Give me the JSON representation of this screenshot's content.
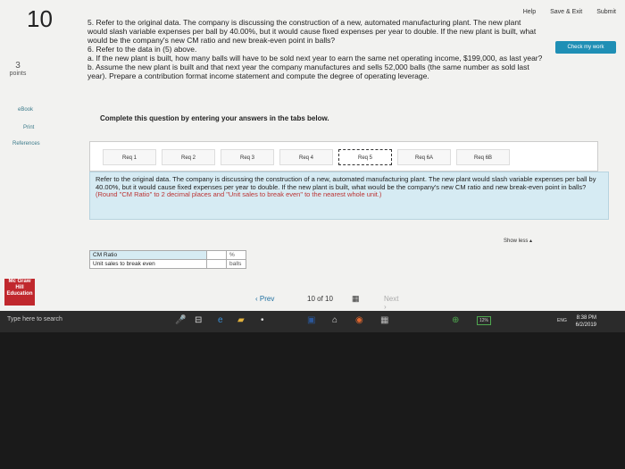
{
  "header": {
    "question_number": "10",
    "help": "Help",
    "save_exit": "Save & Exit",
    "submit": "Submit",
    "check_work": "Check my work"
  },
  "sidebar": {
    "points_value": "3",
    "points_label": "points",
    "links": [
      "eBook",
      "Print",
      "References"
    ]
  },
  "question": {
    "line1": "5. Refer to the original data. The company is discussing the construction of a new, automated manufacturing plant. The new plant",
    "line2": "would slash variable expenses per ball by 40.00%, but it would cause fixed expenses per year to double. If the new plant is built, what",
    "line3": "would be the company's new CM ratio and new break-even point in balls?",
    "line4": "6. Refer to the data in (5) above.",
    "line5": "a. If the new plant is built, how many balls will have to be sold next year to earn the same net operating income, $199,000, as last year?",
    "line6": "b. Assume the new plant is built and that next year the company manufactures and sells 52,000 balls (the same number as sold last",
    "line7": "year). Prepare a contribution format income statement and compute the degree of operating leverage."
  },
  "instruction": "Complete this question by entering your answers in the tabs below.",
  "tabs": [
    "Req 1",
    "Req 2",
    "Req 3",
    "Req 4",
    "Req 5",
    "Req 6A",
    "Req 6B"
  ],
  "active_tab": "Req 5",
  "req_panel": {
    "text": "Refer to the original data. The company is discussing the construction of a new, automated manufacturing plant. The new plant would slash variable expenses per ball by 40.00%, but it would cause fixed expenses per year to double. If the new plant is built, what would be the company's new CM ratio and new break-even point in balls?",
    "round_note": "(Round \"CM Ratio\" to 2 decimal places and \"Unit sales to break even\" to the nearest whole unit.)",
    "show_less": "Show less ▴"
  },
  "answer_rows": [
    {
      "label": "CM Ratio",
      "value": "",
      "unit": "%"
    },
    {
      "label": "Unit sales to break even",
      "value": "",
      "unit": "balls"
    }
  ],
  "logo_text": "Mc Graw Hill Education",
  "pager": {
    "prev": "‹ Prev",
    "current": "10",
    "of": "of",
    "total": "10",
    "next": "Next ›"
  },
  "taskbar": {
    "search_placeholder": "Type here to search",
    "battery": "12%",
    "language": "ENG",
    "time": "8:38 PM",
    "date": "6/2/2019"
  }
}
